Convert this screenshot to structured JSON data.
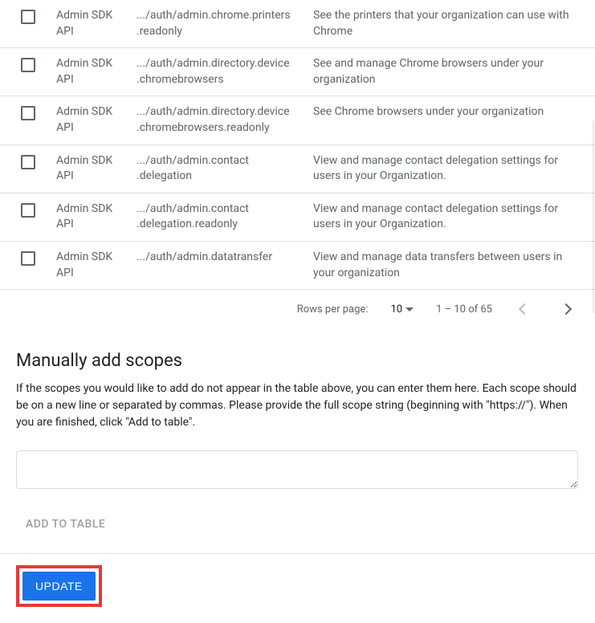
{
  "table": {
    "rows": [
      {
        "api": "Admin SDK API",
        "scope": ".../auth/admin.chrome.printers .readonly",
        "desc": "See the printers that your organization can use with Chrome"
      },
      {
        "api": "Admin SDK API",
        "scope": ".../auth/admin.directory.device .chromebrowsers",
        "desc": "See and manage Chrome browsers under your organization"
      },
      {
        "api": "Admin SDK API",
        "scope": ".../auth/admin.directory.device .chromebrowsers.readonly",
        "desc": "See Chrome browsers under your organization"
      },
      {
        "api": "Admin SDK API",
        "scope": ".../auth/admin.contact .delegation",
        "desc": "View and manage contact delegation settings for users in your Organization."
      },
      {
        "api": "Admin SDK API",
        "scope": ".../auth/admin.contact .delegation.readonly",
        "desc": "View and manage contact delegation settings for users in your Organization."
      },
      {
        "api": "Admin SDK API",
        "scope": ".../auth/admin.datatransfer",
        "desc": "View and manage data transfers between users in your organization"
      }
    ]
  },
  "pagination": {
    "rows_per_page_label": "Rows per page:",
    "rows_per_page_value": "10",
    "range": "1 – 10 of 65"
  },
  "manual": {
    "heading": "Manually add scopes",
    "description": "If the scopes you would like to add do not appear in the table above, you can enter them here. Each scope should be on a new line or separated by commas. Please provide the full scope string (beginning with \"https://\"). When you are finished, click \"Add to table\".",
    "add_button": "ADD TO TABLE"
  },
  "footer": {
    "update": "UPDATE"
  }
}
